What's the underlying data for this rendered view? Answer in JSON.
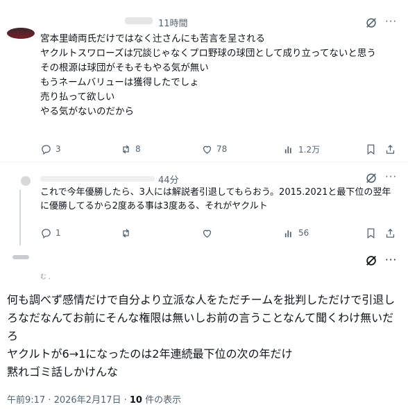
{
  "tweets": [
    {
      "time": "11時間",
      "text": "宮本里崎両氏だけではなく辻さんにも苦言を呈される\nヤクルトスワローズは冗談じゃなくプロ野球の球団として成り立ってないと思う\nその根源は球団がそもそもやる気が無い\nもうネームバリューは獲得したでしょ\n売り払って欲しい\nやる気がないのだから",
      "replies": "3",
      "reposts": "8",
      "likes": "78",
      "views": "1.2万"
    },
    {
      "time": "44分",
      "text": "これで今年優勝したら、3人には解説者引退してもらおう。2015.2021と最下位の翌年に優勝してるから2度ある事は3度ある、それがヤクルト",
      "replies": "1",
      "reposts": "",
      "likes": "",
      "views": "56"
    }
  ],
  "main": {
    "handle_fragment": "む ,",
    "text": "何も調べず感情だけで自分より立派な人をただチームを批判しただけで引退しろなだなんてお前にそんな権限は無いしお前の言うことなんて聞くわけ無いだろ\nヤクルトが6→1になったのは2年連続最下位の次の年だけ\n黙れゴミ話しかけんな",
    "timestamp": "午前9:17 · 2026年2月17日 · ",
    "views_count": "10",
    "views_label": " 件の表示"
  },
  "icons": [
    "grok-icon",
    "more-icon",
    "reply-icon",
    "repost-icon",
    "like-icon",
    "views-icon",
    "bookmark-icon",
    "share-icon"
  ]
}
